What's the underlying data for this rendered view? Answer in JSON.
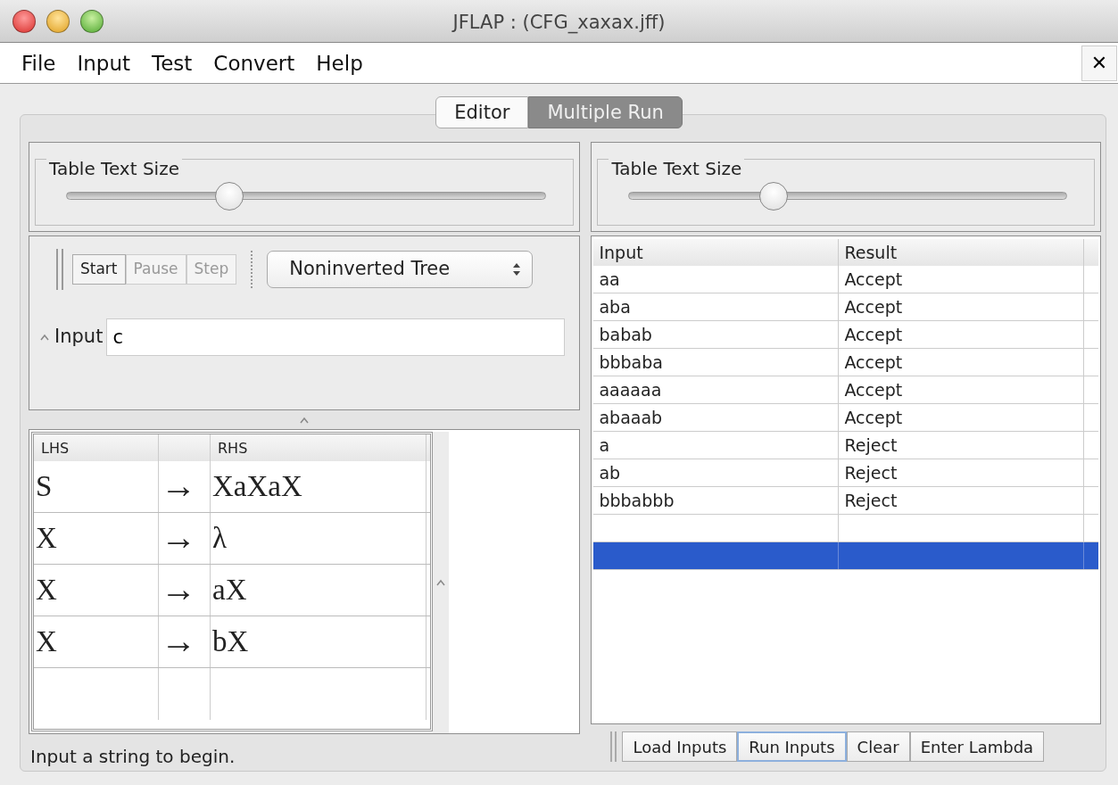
{
  "window": {
    "title": "JFLAP : (CFG_xaxax.jff)",
    "close": "✕"
  },
  "menu": [
    "File",
    "Input",
    "Test",
    "Convert",
    "Help"
  ],
  "tabs": [
    {
      "label": "Editor",
      "selected": false
    },
    {
      "label": "Multiple Run",
      "selected": true
    }
  ],
  "left": {
    "slider": {
      "label": "Table Text Size",
      "level": 0.34
    },
    "toolbar": [
      {
        "label": "Start",
        "disabled": false
      },
      {
        "label": "Pause",
        "disabled": true
      },
      {
        "label": "Step",
        "disabled": true
      }
    ],
    "view_select": "Noninverted Tree",
    "input": {
      "label": "Input",
      "value": "c"
    },
    "grammar": {
      "lhs_heading": "LHS",
      "rhs_heading": "RHS",
      "rows": [
        {
          "lhs": "S",
          "arrow": "→",
          "rhs": "XaXaX"
        },
        {
          "lhs": "X",
          "arrow": "→",
          "rhs": "λ"
        },
        {
          "lhs": "X",
          "arrow": "→",
          "rhs": "aX"
        },
        {
          "lhs": "X",
          "arrow": "→",
          "rhs": "bX"
        }
      ]
    },
    "status": "Input a string to begin."
  },
  "right": {
    "slider": {
      "label": "Table Text Size",
      "level": 0.33
    },
    "results": {
      "columns": [
        "Input",
        "Result"
      ],
      "rows": [
        {
          "input": "aa",
          "result": "Accept",
          "selected": false
        },
        {
          "input": "aba",
          "result": "Accept",
          "selected": false
        },
        {
          "input": "babab",
          "result": "Accept",
          "selected": false
        },
        {
          "input": "bbbaba",
          "result": "Accept",
          "selected": false
        },
        {
          "input": "aaaaaa",
          "result": "Accept",
          "selected": false
        },
        {
          "input": "abaaab",
          "result": "Accept",
          "selected": false
        },
        {
          "input": "a",
          "result": "Reject",
          "selected": false
        },
        {
          "input": "ab",
          "result": "Reject",
          "selected": false
        },
        {
          "input": "bbbabbb",
          "result": "Reject",
          "selected": false
        }
      ],
      "blank_rows": [
        {
          "selected": false
        },
        {
          "selected": true
        }
      ]
    },
    "buttons": [
      {
        "label": "Load Inputs",
        "focused": false
      },
      {
        "label": "Run Inputs",
        "focused": true
      },
      {
        "label": "Clear",
        "focused": false
      },
      {
        "label": "Enter Lambda",
        "focused": false
      }
    ]
  }
}
